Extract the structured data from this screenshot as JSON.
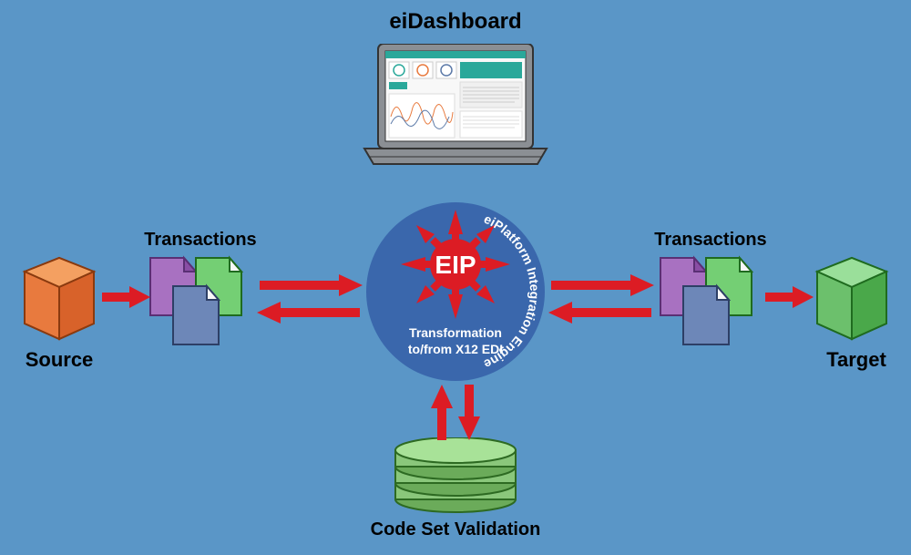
{
  "title_top": "eiDashboard",
  "source_label": "Source",
  "target_label": "Target",
  "transactions_left": "Transactions",
  "transactions_right": "Transactions",
  "code_set_validation": "Code Set Validation",
  "eip_center": "EIP",
  "eip_transformation1": "Transformation",
  "eip_transformation2": "to/from X12 EDI",
  "eip_ring": "eiPlatform Integration Engine",
  "colors": {
    "bg": "#5a96c7",
    "red": "#dc1c24",
    "blue_circle": "#3a67ac",
    "orange": "#e87a3e",
    "green": "#6cc06c",
    "purple": "#9b5fb5",
    "slate": "#5c7aa8",
    "cyl_green": "#8ac77b"
  }
}
